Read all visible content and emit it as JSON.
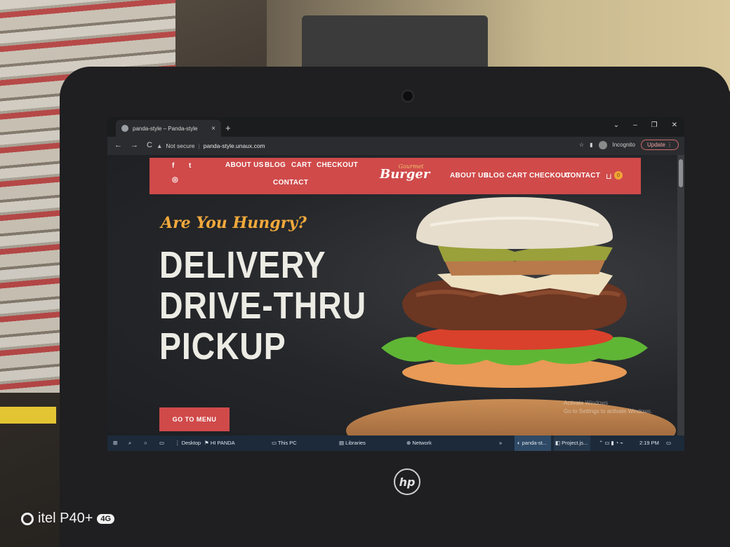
{
  "browser": {
    "tab_title": "panda-style – Panda-style",
    "tab_close": "×",
    "new_tab": "+",
    "nav": {
      "back": "←",
      "forward": "→",
      "reload": "C"
    },
    "security_label": "Not secure",
    "url": "panda-style.unaux.com",
    "profile_label": "Incognito",
    "update_label": "Update",
    "window_controls": [
      "⌄",
      "–",
      "❐",
      "✕"
    ]
  },
  "site": {
    "social": {
      "facebook": "f",
      "twitter": "t",
      "instagram": "◎"
    },
    "nav_left": [
      "ABOUT US",
      "BLOG",
      "CART",
      "CHECKOUT",
      "CONTACT"
    ],
    "logo_small": "Gourmet",
    "logo_big": "Burger",
    "nav_right": [
      "ABOUT US",
      "BLOG",
      "CART",
      "CHECKOUT",
      "CONTACT"
    ],
    "cart_count": "0",
    "tagline": "Are You Hungry?",
    "headline": [
      "DELIVERY",
      "DRIVE-THRU",
      "PICKUP"
    ],
    "cta": "GO TO MENU",
    "activate_windows": [
      "Activate Windows",
      "Go to Settings to activate Windows."
    ]
  },
  "taskbar": {
    "items": [
      "Desktop",
      "HI PANDA",
      "This PC",
      "Libraries",
      "Network",
      "panda-st...",
      "Project.js..."
    ],
    "time": "2:19 PM"
  },
  "device": {
    "brand": "hp",
    "watermark": "itel P40+",
    "network_badge": "4G"
  },
  "colors": {
    "accent": "#d04a4a",
    "tagline": "#f2a93b"
  }
}
